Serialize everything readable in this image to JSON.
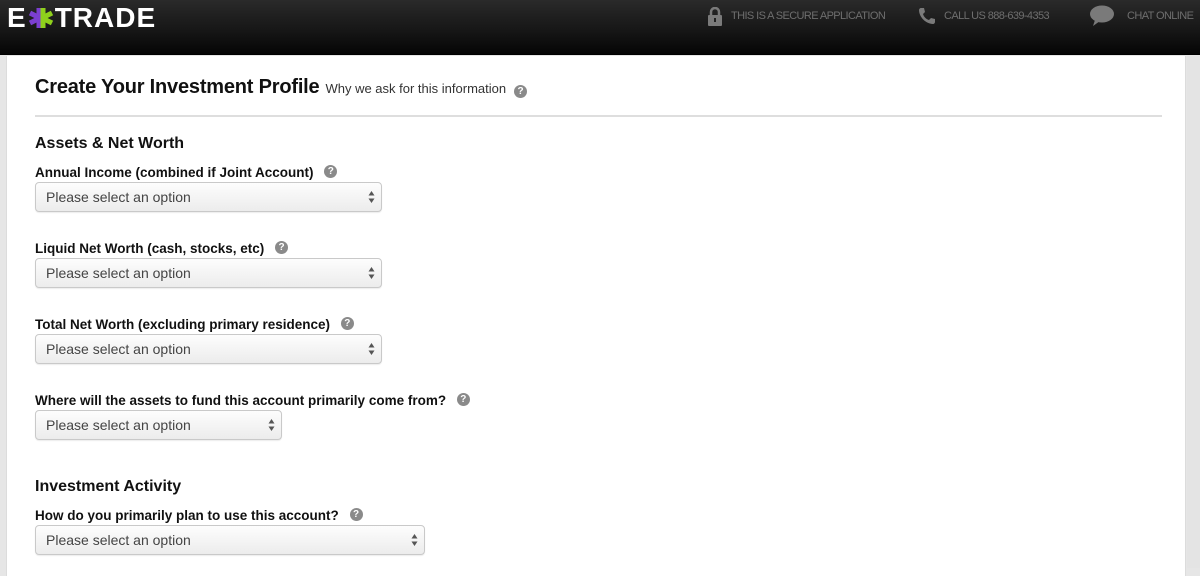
{
  "header": {
    "logo": {
      "left": "E",
      "right": "TRADE"
    },
    "secure_text": "THIS IS A SECURE APPLICATION",
    "call_text": "CALL US 888-639-4353",
    "chat_text": "CHAT ONLINE"
  },
  "colors": {
    "logo_purple": "#7b3fd0",
    "logo_green": "#8fd11c",
    "topbar": "#151515"
  },
  "main": {
    "title": "Create Your Investment Profile",
    "why_link": "Why we ask for this information",
    "help_glyph": "?",
    "sections": [
      {
        "title": "Assets & Net Worth",
        "fields": [
          {
            "label": "Annual Income (combined if Joint Account)",
            "value": "Please select an option"
          },
          {
            "label": "Liquid Net Worth (cash, stocks, etc)",
            "value": "Please select an option"
          },
          {
            "label": "Total Net Worth (excluding primary residence)",
            "value": "Please select an option"
          },
          {
            "label": "Where will the assets to fund this account primarily come from?",
            "value": "Please select an option"
          }
        ]
      },
      {
        "title": "Investment Activity",
        "fields": [
          {
            "label": "How do you primarily plan to use this account?",
            "value": "Please select an option"
          }
        ]
      }
    ]
  }
}
